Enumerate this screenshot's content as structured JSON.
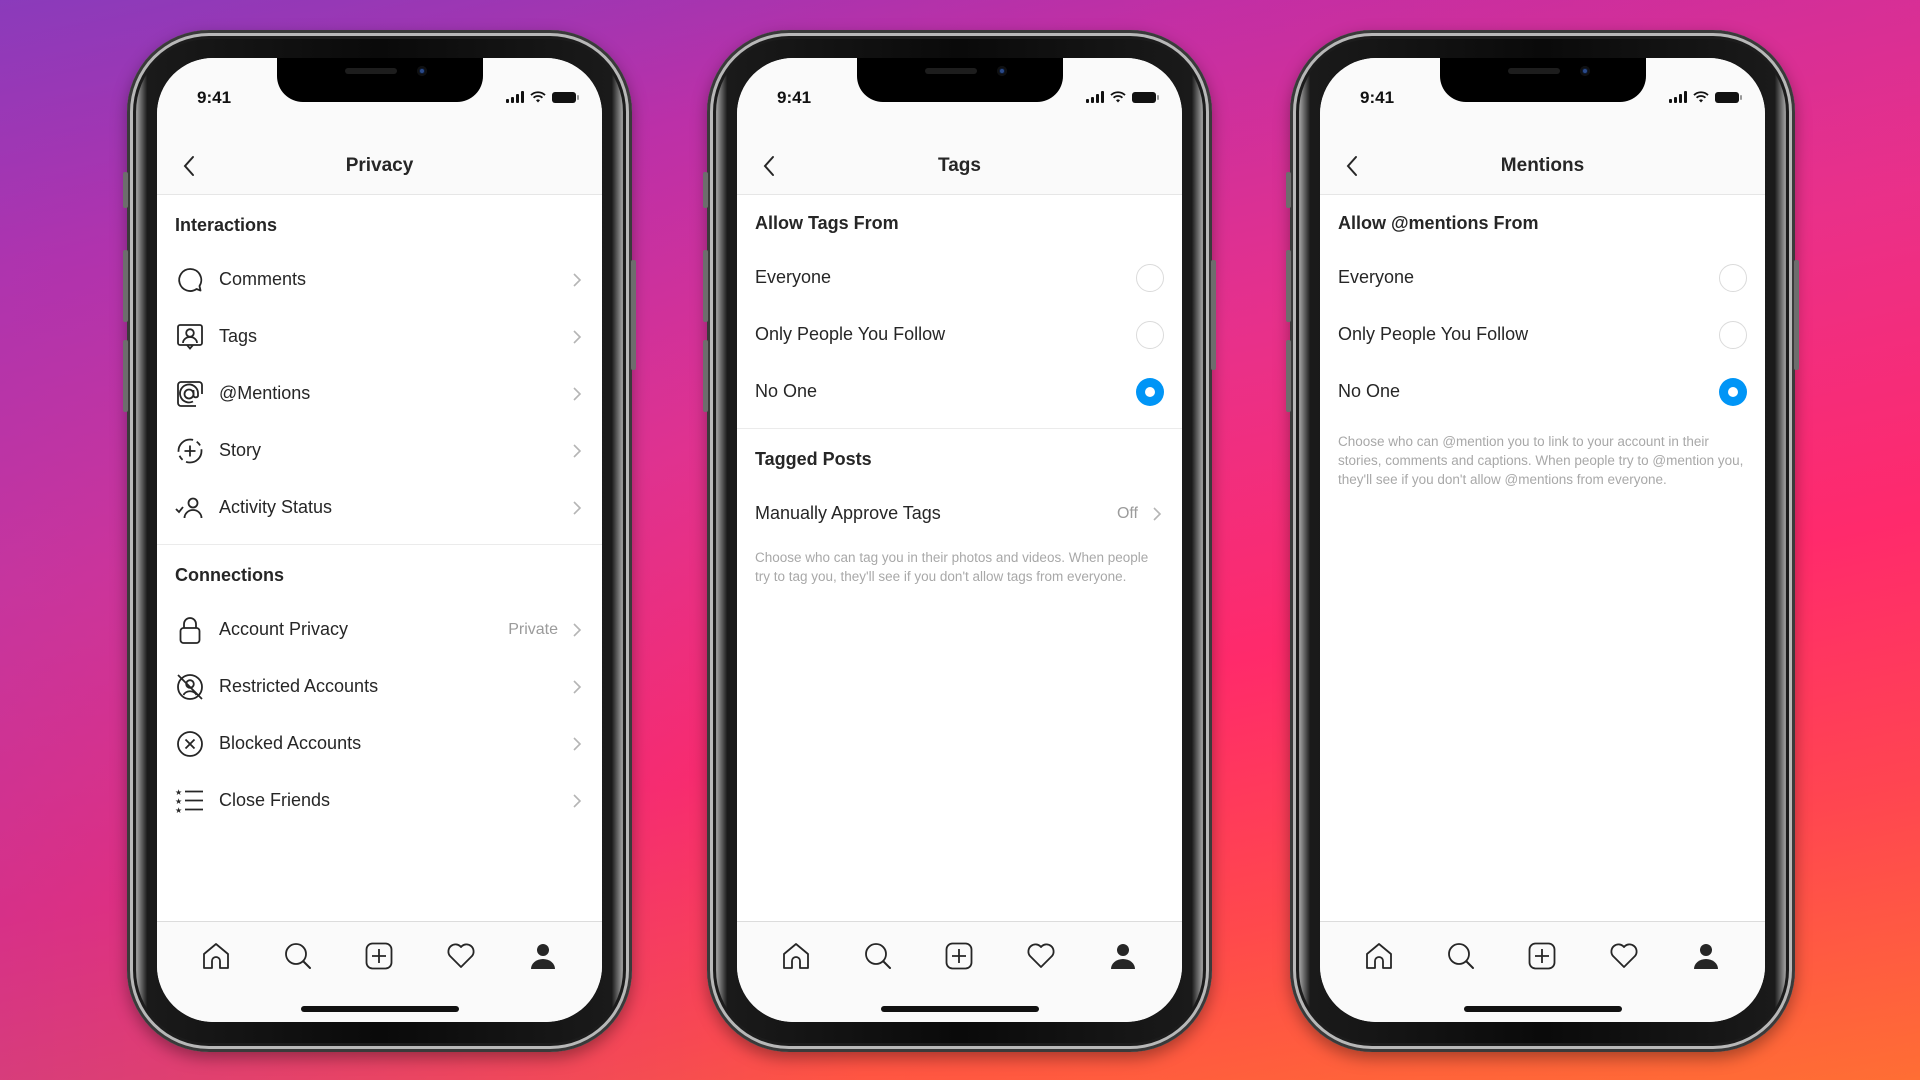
{
  "background": {
    "gradient_colors": [
      "#8a3ab9",
      "#c02fa6",
      "#e6318c",
      "#ff2a6a",
      "#ff4a4a",
      "#ff7a28"
    ]
  },
  "accent_color": "#0095f6",
  "phones": [
    {
      "status_bar": {
        "time": "9:41",
        "icons": [
          "signal-icon",
          "wifi-icon",
          "battery-icon"
        ]
      },
      "nav": {
        "back_icon": "chevron-left-icon",
        "title": "Privacy"
      },
      "sections": [
        {
          "title": "Interactions",
          "items": [
            {
              "icon": "comment-bubble-icon",
              "label": "Comments",
              "value": ""
            },
            {
              "icon": "tag-person-icon",
              "label": "Tags",
              "value": ""
            },
            {
              "icon": "at-sign-icon",
              "label": "@Mentions",
              "value": ""
            },
            {
              "icon": "story-add-icon",
              "label": "Story",
              "value": ""
            },
            {
              "icon": "activity-status-icon",
              "label": "Activity Status",
              "value": ""
            }
          ]
        },
        {
          "title": "Connections",
          "items": [
            {
              "icon": "lock-icon",
              "label": "Account Privacy",
              "value": "Private"
            },
            {
              "icon": "restricted-icon",
              "label": "Restricted Accounts",
              "value": ""
            },
            {
              "icon": "blocked-icon",
              "label": "Blocked Accounts",
              "value": ""
            },
            {
              "icon": "close-friends-list-icon",
              "label": "Close Friends",
              "value": ""
            }
          ]
        }
      ]
    },
    {
      "status_bar": {
        "time": "9:41",
        "icons": [
          "signal-icon",
          "wifi-icon",
          "battery-icon"
        ]
      },
      "nav": {
        "back_icon": "chevron-left-icon",
        "title": "Tags"
      },
      "allow_section": {
        "title": "Allow Tags From",
        "options": [
          {
            "label": "Everyone",
            "selected": false
          },
          {
            "label": "Only People You Follow",
            "selected": false
          },
          {
            "label": "No One",
            "selected": true
          }
        ]
      },
      "tagged_posts": {
        "title": "Tagged Posts",
        "row": {
          "label": "Manually Approve Tags",
          "value": "Off"
        },
        "help_text": "Choose who can tag you in their photos and videos. When people try to tag you, they'll see if you don't allow tags from everyone."
      }
    },
    {
      "status_bar": {
        "time": "9:41",
        "icons": [
          "signal-icon",
          "wifi-icon",
          "battery-icon"
        ]
      },
      "nav": {
        "back_icon": "chevron-left-icon",
        "title": "Mentions"
      },
      "allow_section": {
        "title": "Allow @mentions From",
        "options": [
          {
            "label": "Everyone",
            "selected": false
          },
          {
            "label": "Only People You Follow",
            "selected": false
          },
          {
            "label": "No One",
            "selected": true
          }
        ]
      },
      "help_text": "Choose who can @mention you to link to your account in their stories, comments and captions. When people try to @mention you, they'll see if you don't allow @mentions from everyone."
    }
  ],
  "tab_bar": {
    "items": [
      {
        "icon": "home-icon",
        "label": "Home"
      },
      {
        "icon": "search-icon",
        "label": "Search"
      },
      {
        "icon": "new-post-icon",
        "label": "New Post"
      },
      {
        "icon": "heart-icon",
        "label": "Activity"
      },
      {
        "icon": "profile-icon",
        "label": "Profile"
      }
    ]
  }
}
